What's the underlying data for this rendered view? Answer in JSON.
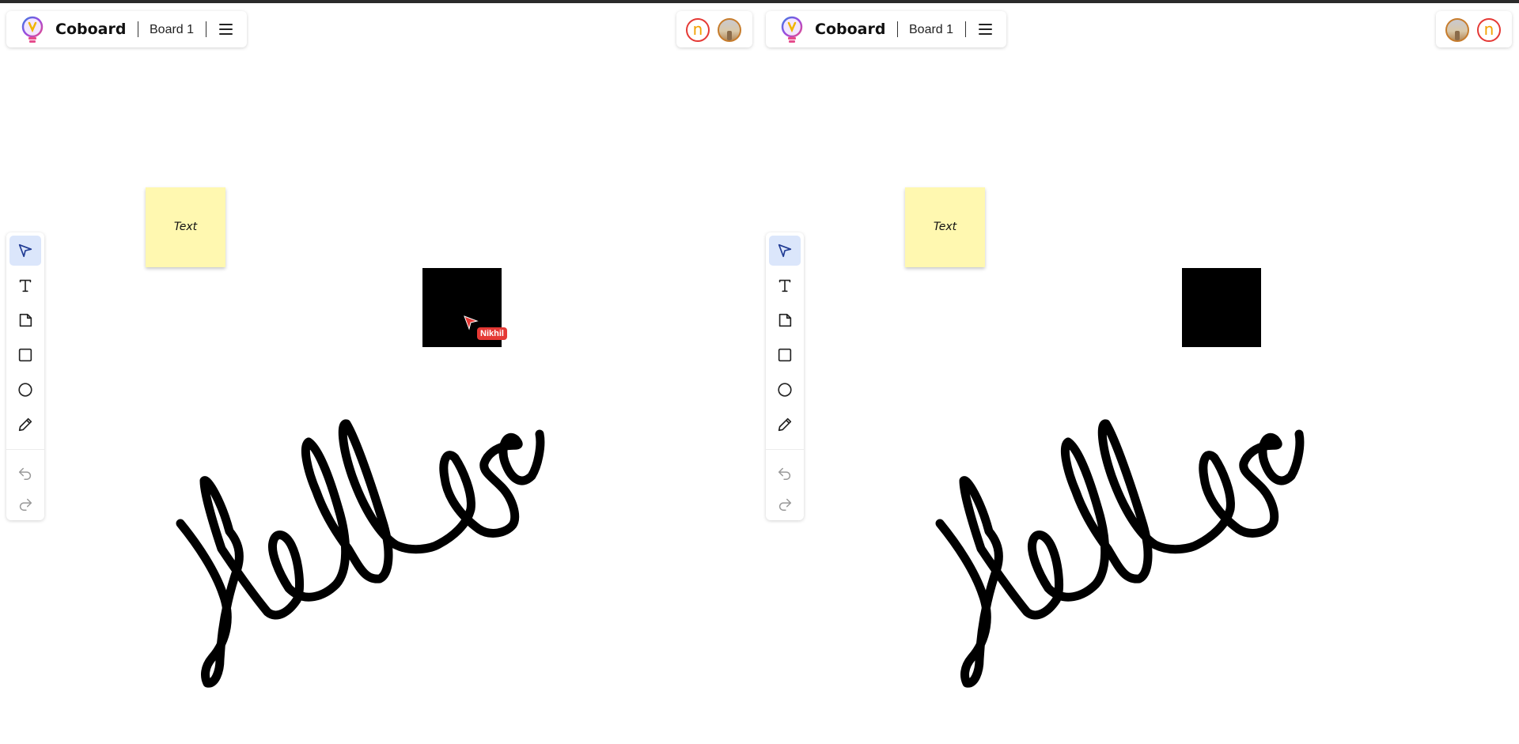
{
  "app": {
    "name": "Coboard",
    "board_name": "Board 1"
  },
  "left_view": {
    "avatars": [
      "n",
      "photo"
    ]
  },
  "right_view": {
    "avatars": [
      "photo",
      "n"
    ]
  },
  "avatar_initial": "n",
  "toolbar": {
    "tools": [
      "select-tool",
      "text-tool",
      "sticky-note-tool",
      "rectangle-tool",
      "ellipse-tool",
      "pencil-tool"
    ],
    "history": [
      "undo",
      "redo"
    ],
    "active_tool": "select-tool"
  },
  "canvas": {
    "sticky_note_text": "Text",
    "sticky_note_color": "#fff8b0",
    "square_color": "#000000",
    "remote_cursor": {
      "name": "Nikhil",
      "color": "#e53935"
    }
  },
  "colors": {
    "accent": "#1f3a93",
    "active_tool_bg": "#dbe6fb",
    "avatar_ring": "#e53935",
    "avatar_initial": "#f2a100"
  }
}
